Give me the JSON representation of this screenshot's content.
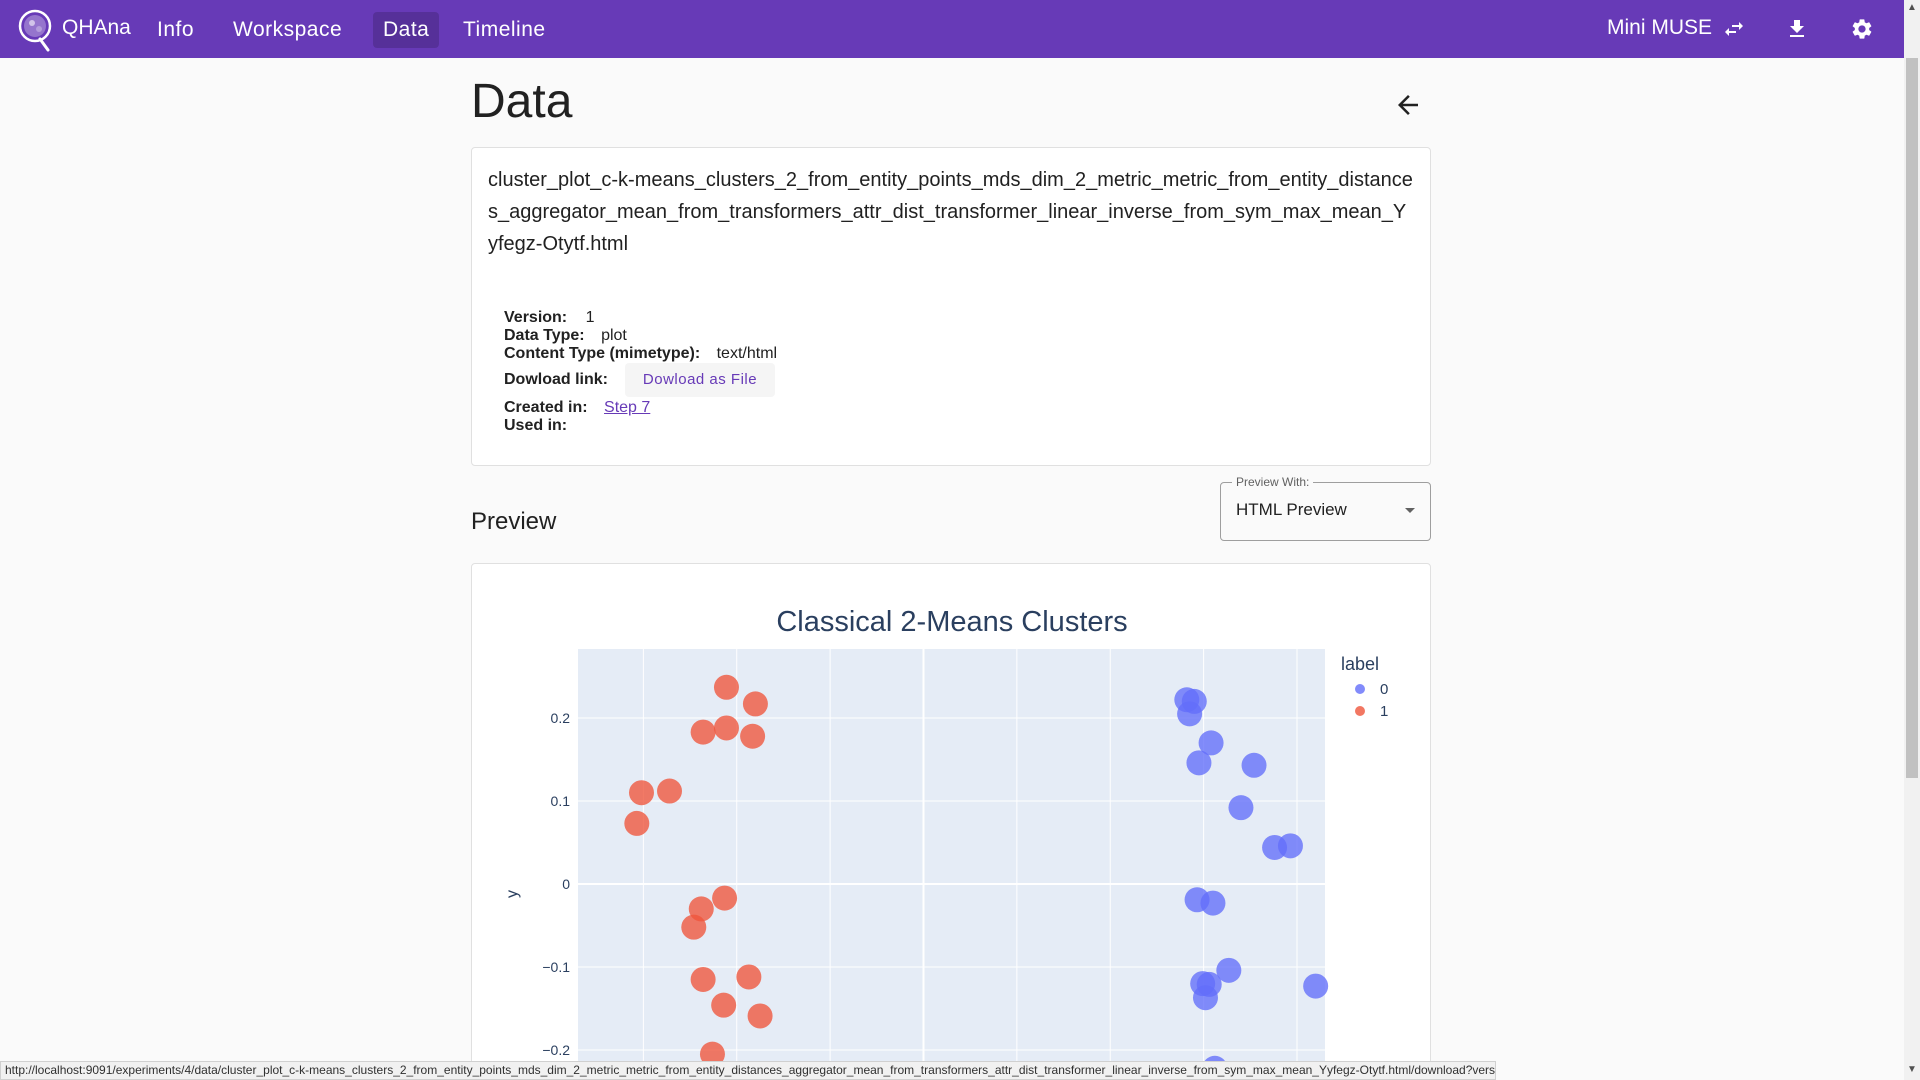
{
  "appbar": {
    "brand": "QHAna",
    "nav": [
      "Info",
      "Workspace",
      "Data",
      "Timeline"
    ],
    "active_nav": "Data",
    "plugin_name": "Mini MUSE",
    "icons": [
      "swap-icon",
      "download-icon",
      "settings-icon"
    ],
    "color": "#673ab7"
  },
  "page": {
    "title": "Data",
    "filename": "cluster_plot_c-k-means_clusters_2_from_entity_points_mds_dim_2_metric_metric_from_entity_distances_aggregator_mean_from_transformers_attr_dist_transformer_linear_inverse_from_sym_max_mean_Yyfegz-Otytf.html",
    "version_label": "Version:",
    "version": "1",
    "data_type_label": "Data Type:",
    "data_type": "plot",
    "content_type_label": "Content Type (mimetype):",
    "content_type": "text/html",
    "download_label": "Dowload link:",
    "download_button": "Dowload as File",
    "created_label": "Created in:",
    "created_value": "Step 7",
    "used_label": "Used in:",
    "used_value": ""
  },
  "preview": {
    "heading": "Preview",
    "select_legend": "Preview With:",
    "select_value": "HTML Preview"
  },
  "chart_data": {
    "type": "scatter",
    "title": "Classical 2-Means Clusters",
    "xlabel": "",
    "ylabel": "y",
    "legend_title": "label",
    "legend_placement": "top-right",
    "y_ticks": [
      "0.2",
      "0.1",
      "0",
      "−0.1",
      "−0.2"
    ],
    "grid": true,
    "series": [
      {
        "name": "0",
        "color": "#636efa",
        "points": [
          [
            0.282,
            0.222
          ],
          [
            0.29,
            0.22
          ],
          [
            0.285,
            0.205
          ],
          [
            0.308,
            0.17
          ],
          [
            0.354,
            0.143
          ],
          [
            0.295,
            0.146
          ],
          [
            0.34,
            0.092
          ],
          [
            0.376,
            0.044
          ],
          [
            0.393,
            0.046
          ],
          [
            0.293,
            -0.019
          ],
          [
            0.31,
            -0.023
          ],
          [
            0.299,
            -0.12
          ],
          [
            0.306,
            -0.121
          ],
          [
            0.302,
            -0.137
          ],
          [
            0.327,
            -0.104
          ],
          [
            0.42,
            -0.123
          ],
          [
            0.312,
            -0.222
          ]
        ]
      },
      {
        "name": "1",
        "color": "#ef553b",
        "points": [
          [
            -0.211,
            0.237
          ],
          [
            -0.18,
            0.217
          ],
          [
            -0.236,
            0.183
          ],
          [
            -0.211,
            0.188
          ],
          [
            -0.183,
            0.178
          ],
          [
            -0.302,
            0.11
          ],
          [
            -0.272,
            0.112
          ],
          [
            -0.307,
            0.073
          ],
          [
            -0.213,
            -0.017
          ],
          [
            -0.238,
            -0.03
          ],
          [
            -0.246,
            -0.052
          ],
          [
            -0.236,
            -0.115
          ],
          [
            -0.187,
            -0.112
          ],
          [
            -0.214,
            -0.146
          ],
          [
            -0.175,
            -0.159
          ],
          [
            -0.226,
            -0.205
          ]
        ]
      }
    ]
  },
  "statusbar": {
    "url": "http://localhost:9091/experiments/4/data/cluster_plot_c-k-means_clusters_2_from_entity_points_mds_dim_2_metric_metric_from_entity_distances_aggregator_mean_from_transformers_attr_dist_transformer_linear_inverse_from_sym_max_mean_Yyfegz-Otytf.html/download?version=1"
  }
}
